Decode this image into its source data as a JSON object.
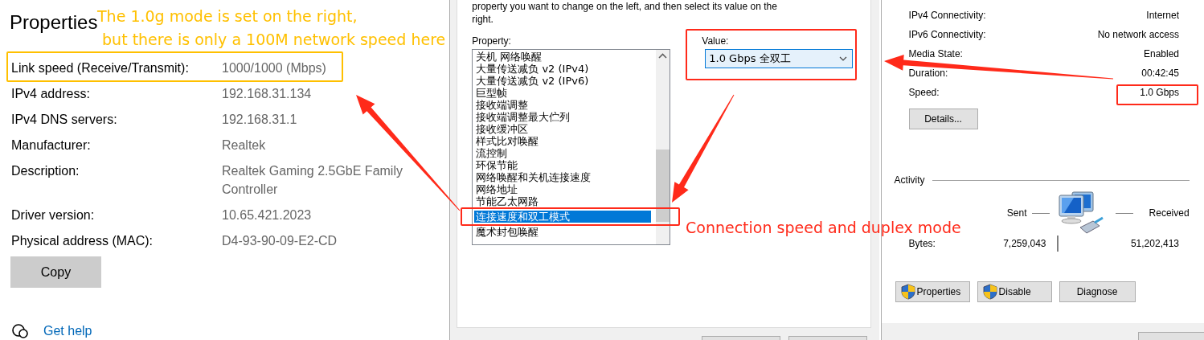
{
  "settings_panel": {
    "title": "Properties",
    "rows": [
      {
        "label": "Link speed (Receive/Transmit):",
        "value": "1000/1000 (Mbps)"
      },
      {
        "label": "IPv4 address:",
        "value": "192.168.31.134"
      },
      {
        "label": "IPv4 DNS servers:",
        "value": "192.168.31.1"
      },
      {
        "label": "Manufacturer:",
        "value": "Realtek"
      },
      {
        "label": "Description:",
        "value": "Realtek Gaming 2.5GbE Family Controller"
      },
      {
        "label": "Driver version:",
        "value": "10.65.421.2023"
      },
      {
        "label": "Physical address (MAC):",
        "value": "D4-93-90-09-E2-CD"
      }
    ],
    "copy_button": "Copy",
    "help_link": "Get help"
  },
  "advanced_dialog": {
    "instructions": "property you want to change on the left, and then select its value on the right.",
    "property_label": "Property:",
    "properties": [
      {
        "label": "关机 网络唤醒",
        "selected": false
      },
      {
        "label": "大量传送减负 v2 (IPv4)",
        "selected": false
      },
      {
        "label": "大量传送减负 v2 (IPv6)",
        "selected": false
      },
      {
        "label": "巨型帧",
        "selected": false
      },
      {
        "label": "接收端调整",
        "selected": false
      },
      {
        "label": "接收端调整最大伫列",
        "selected": false
      },
      {
        "label": "接收缓冲区",
        "selected": false
      },
      {
        "label": "样式比对唤醒",
        "selected": false
      },
      {
        "label": "流控制",
        "selected": false
      },
      {
        "label": "环保节能",
        "selected": false
      },
      {
        "label": "网络唤醒和关机连接速度",
        "selected": false
      },
      {
        "label": "网络地址",
        "selected": false
      },
      {
        "label": "节能乙太网路",
        "selected": false
      },
      {
        "label": "连接速度和双工模式",
        "selected": true
      },
      {
        "label": "魔术封包唤醒",
        "selected": false
      }
    ],
    "value_label": "Value:",
    "value": "1.0 Gbps 全双工"
  },
  "status_dialog": {
    "rows": [
      {
        "label": "IPv4 Connectivity:",
        "value": "Internet"
      },
      {
        "label": "IPv6 Connectivity:",
        "value": "No network access"
      },
      {
        "label": "Media State:",
        "value": "Enabled"
      },
      {
        "label": "Duration:",
        "value": "00:42:45"
      },
      {
        "label": "Speed:",
        "value": "1.0 Gbps"
      }
    ],
    "details_button": "Details...",
    "activity_label": "Activity",
    "sent_label": "Sent",
    "received_label": "Received",
    "bytes_label": "Bytes:",
    "bytes_sent": "7,259,043",
    "bytes_received": "51,202,413",
    "buttons": [
      {
        "label": "Properties",
        "shield": true
      },
      {
        "label": "Disable",
        "shield": true
      },
      {
        "label": "Diagnose",
        "shield": false
      }
    ]
  },
  "annotations": {
    "notes": [
      {
        "text": "The 1.0g mode is set on the right,\n but there is only a 100M network speed here",
        "color": "#ffc000"
      },
      {
        "text": "Connection speed and duplex mode",
        "color": "#ff2a1a"
      }
    ],
    "boxes": [
      {
        "color": "#ffc000"
      },
      {
        "color": "#ff2a1a"
      },
      {
        "color": "#ff2a1a"
      },
      {
        "color": "#ff2a1a"
      }
    ],
    "arrows": [
      {
        "color": "#ff2a1a"
      },
      {
        "color": "#ff2a1a"
      },
      {
        "color": "#ff2a1a"
      }
    ]
  }
}
